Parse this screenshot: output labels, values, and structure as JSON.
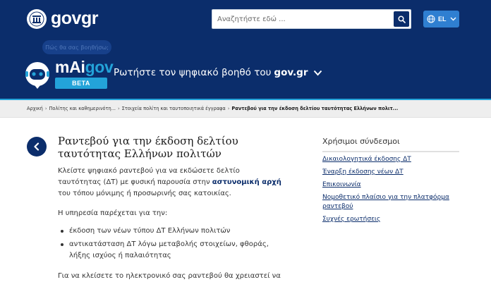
{
  "header": {
    "logo_text": "govgr",
    "search": {
      "placeholder": "Αναζητήστε εδώ ..."
    },
    "language": {
      "label": "EL"
    },
    "bubble_text": "Πώς θα σας βοηθήσω;",
    "mai": {
      "title_prefix": "mAi",
      "title_accent": "gov",
      "beta": "BETA"
    },
    "assistant": {
      "text": "Ρωτήστε τον ψηφιακό βοηθό του",
      "brand": "gov.gr"
    }
  },
  "breadcrumb": [
    "Αρχική",
    "Πολίτης και καθημερινότη...",
    "Στοιχεία πολίτη και ταυτοποιητικά έγγραφα",
    "Ραντεβού για την έκδοση δελτίου ταυτότητας Ελλήνων πολιτ..."
  ],
  "main": {
    "title": "Ραντεβού για την έκδοση δελτίου ταυτότητας Ελλήνων πολιτών",
    "intro_before": "Κλείστε ψηφιακό ραντεβού για να εκδώσετε δελτίο ταυτότητας (ΔΤ) με φυσική παρουσία στην",
    "intro_link": "αστυνομική αρχή",
    "intro_after": "του τόπου μόνιμης ή προσωρινής σας κατοικίας.",
    "services_intro": "Η υπηρεσία παρέχεται για την:",
    "bullets": [
      "έκδοση των νέων τύπου ΔΤ Ελλήνων πολιτών",
      "αντικατάσταση ΔΤ λόγω μεταβολής στοιχείων, φθοράς, λήξης ισχύος ή παλαιότητας"
    ],
    "closing": "Για να κλείσετε το ηλεκτρονικό σας ραντεβού θα χρειαστεί να"
  },
  "sidebar": {
    "title": "Χρήσιμοι σύνδεσμοι",
    "links": [
      "Δικαιολογητικά έκδοσης ΔΤ",
      "Έναρξη έκδοσης νέων ΔΤ",
      "Επικοινωνία",
      "Νομοθετικό πλαίσιο για την πλατφόρμα ραντεβού",
      "Συχνές ερωτήσεις"
    ]
  },
  "colors": {
    "header_bg": "#0b2d6b",
    "accent": "#23a3d9",
    "language_button": "#2f7fd1",
    "link": "#0b2d6b"
  },
  "icons": [
    "govgr-emblem-icon",
    "search-icon",
    "globe-icon",
    "chevron-down-icon",
    "robot-icon",
    "back-arrow-icon"
  ]
}
